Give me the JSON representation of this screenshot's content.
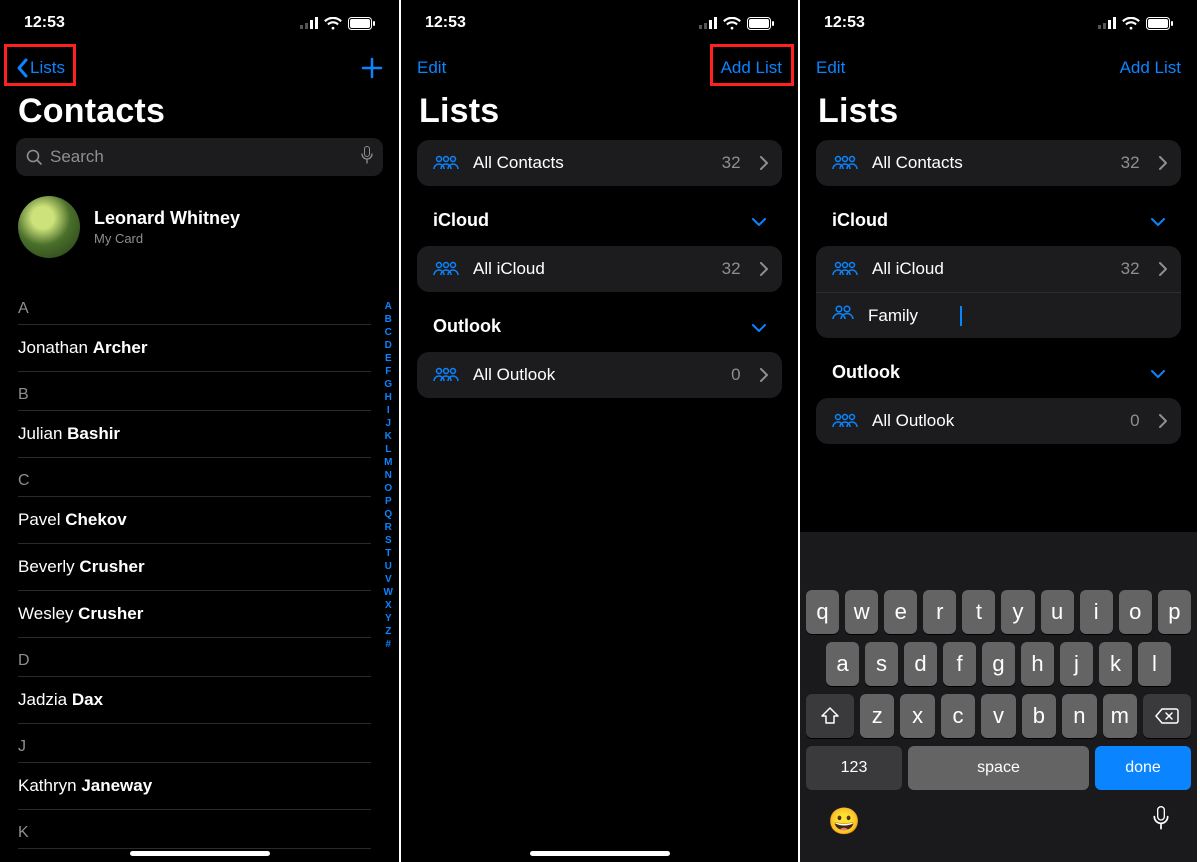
{
  "status": {
    "time": "12:53"
  },
  "screen1": {
    "nav_back": "Lists",
    "title": "Contacts",
    "search_placeholder": "Search",
    "mycard": {
      "name": "Leonard Whitney",
      "sub": "My Card"
    },
    "sections": [
      {
        "letter": "A",
        "rows": [
          {
            "first": "Jonathan",
            "last": "Archer"
          }
        ]
      },
      {
        "letter": "B",
        "rows": [
          {
            "first": "Julian",
            "last": "Bashir"
          }
        ]
      },
      {
        "letter": "C",
        "rows": [
          {
            "first": "Pavel",
            "last": "Chekov"
          },
          {
            "first": "Beverly",
            "last": "Crusher"
          },
          {
            "first": "Wesley",
            "last": "Crusher"
          }
        ]
      },
      {
        "letter": "D",
        "rows": [
          {
            "first": "Jadzia",
            "last": "Dax"
          }
        ]
      },
      {
        "letter": "J",
        "rows": [
          {
            "first": "Kathryn",
            "last": "Janeway"
          }
        ]
      },
      {
        "letter": "K",
        "rows": []
      }
    ],
    "index": [
      "A",
      "B",
      "C",
      "D",
      "E",
      "F",
      "G",
      "H",
      "I",
      "J",
      "K",
      "L",
      "M",
      "N",
      "O",
      "P",
      "Q",
      "R",
      "S",
      "T",
      "U",
      "V",
      "W",
      "X",
      "Y",
      "Z",
      "#"
    ]
  },
  "screen2": {
    "nav_left": "Edit",
    "nav_right": "Add List",
    "title": "Lists",
    "all": {
      "label": "All Contacts",
      "count": "32"
    },
    "groups": [
      {
        "name": "iCloud",
        "rows": [
          {
            "label": "All iCloud",
            "count": "32"
          }
        ]
      },
      {
        "name": "Outlook",
        "rows": [
          {
            "label": "All Outlook",
            "count": "0"
          }
        ]
      }
    ]
  },
  "screen3": {
    "nav_left": "Edit",
    "nav_right": "Add List",
    "title": "Lists",
    "all": {
      "label": "All Contacts",
      "count": "32"
    },
    "groups": [
      {
        "name": "iCloud",
        "rows": [
          {
            "label": "All iCloud",
            "count": "32"
          },
          {
            "label_editing": "Family"
          }
        ]
      },
      {
        "name": "Outlook",
        "rows": [
          {
            "label": "All Outlook",
            "count": "0"
          }
        ]
      }
    ],
    "keyboard": {
      "row1": [
        "q",
        "w",
        "e",
        "r",
        "t",
        "y",
        "u",
        "i",
        "o",
        "p"
      ],
      "row2": [
        "a",
        "s",
        "d",
        "f",
        "g",
        "h",
        "j",
        "k",
        "l"
      ],
      "row3": [
        "z",
        "x",
        "c",
        "v",
        "b",
        "n",
        "m"
      ],
      "k123": "123",
      "space": "space",
      "done": "done"
    }
  }
}
